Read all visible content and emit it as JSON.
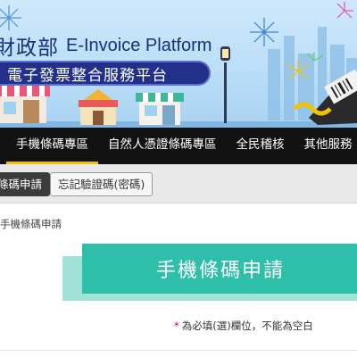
{
  "banner": {
    "brand_cn": "財政部",
    "brand_en": "E-Invoice Platform",
    "subtitle": "電子發票整合服務平台"
  },
  "nav": {
    "items": [
      "手機條碼專區",
      "自然人憑證條碼專區",
      "全民稽核",
      "其他服務"
    ],
    "active_index": 0
  },
  "subtabs": [
    "條碼申請",
    "忘記驗證碼(密碼)"
  ],
  "breadcrumb": "手機條碼申請",
  "page_title": "手機條碼申請",
  "required_note": {
    "star": "*",
    "text": "為必填(選)欄位，不能為空白"
  },
  "colors": {
    "nav_bg": "#121212",
    "nav_active_underline": "#f0c400",
    "title_teal": "#2dbfa9",
    "title_shadow": "#9fe3d7",
    "brand_navy": "#16307a",
    "required_star": "#d0021b"
  }
}
